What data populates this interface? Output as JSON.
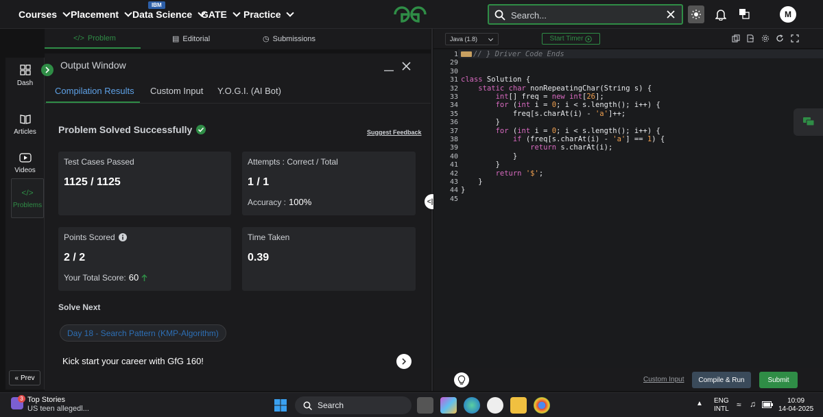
{
  "nav": {
    "courses": "Courses",
    "placement": "Placement",
    "data_science": "Data Science",
    "ibm_badge": "IBM",
    "gate": "GATE",
    "practice": "Practice",
    "search_placeholder": "Search...",
    "avatar_letter": "M"
  },
  "problem_tabs": {
    "problem": "Problem",
    "editorial": "Editorial",
    "submissions": "Submissions"
  },
  "sidebar": {
    "items": [
      {
        "label": "Dash",
        "icon": "dashboard-icon"
      },
      {
        "label": "Articles",
        "icon": "book-icon"
      },
      {
        "label": "Videos",
        "icon": "video-icon"
      },
      {
        "label": "Problems",
        "icon": "code-icon"
      }
    ],
    "prev": "Prev"
  },
  "output": {
    "title": "Output Window",
    "tabs": [
      "Compilation Results",
      "Custom Input",
      "Y.O.G.I. (AI Bot)"
    ],
    "solved": "Problem Solved Successfully",
    "feedback": "Suggest Feedback",
    "tests_label": "Test Cases Passed",
    "tests_value": "1125 / 1125",
    "attempts_label": "Attempts : Correct / Total",
    "attempts_value": "1 / 1",
    "accuracy_label": "Accuracy :",
    "accuracy_value": "100%",
    "points_label": "Points Scored",
    "points_value": "2 / 2",
    "total_score_label": "Your Total Score:",
    "total_score_value": "60",
    "time_label": "Time Taken",
    "time_value": "0.39",
    "solve_next": "Solve Next",
    "next_problem": "Day 18 - Search Pattern (KMP-Algorithm)",
    "kick": "Kick start your career with GfG 160!"
  },
  "editor": {
    "language": "Java (1.8)",
    "timer": "Start Timer",
    "custom_input": "Custom Input",
    "compile_run": "Compile & Run",
    "submit": "Submit",
    "line_numbers": [
      "1",
      "29",
      "30",
      "31",
      "32",
      "33",
      "34",
      "35",
      "36",
      "37",
      "38",
      "39",
      "40",
      "41",
      "42",
      "43",
      "44",
      "45"
    ],
    "code_lines": [
      "// } Driver Code Ends",
      "",
      "",
      "class Solution {",
      "    static char nonRepeatingChar(String s) {",
      "        int[] freq = new int[26];",
      "        for (int i = 0; i < s.length(); i++) {",
      "            freq[s.charAt(i) - 'a']++;",
      "        }",
      "        for (int i = 0; i < s.length(); i++) {",
      "            if (freq[s.charAt(i) - 'a'] == 1) {",
      "                return s.charAt(i);",
      "            }",
      "        }",
      "        return '$';",
      "    }",
      "}",
      ""
    ]
  },
  "taskbar": {
    "news_title": "Top Stories",
    "news_sub": "US teen allegedl...",
    "news_count": "3",
    "search": "Search",
    "lang1": "ENG",
    "lang2": "INTL",
    "time": "10:09",
    "date": "14-04-2025"
  },
  "colors": {
    "accent_green": "#2f8d46",
    "tab_blue": "#5ea1e6",
    "background": "#131314"
  }
}
